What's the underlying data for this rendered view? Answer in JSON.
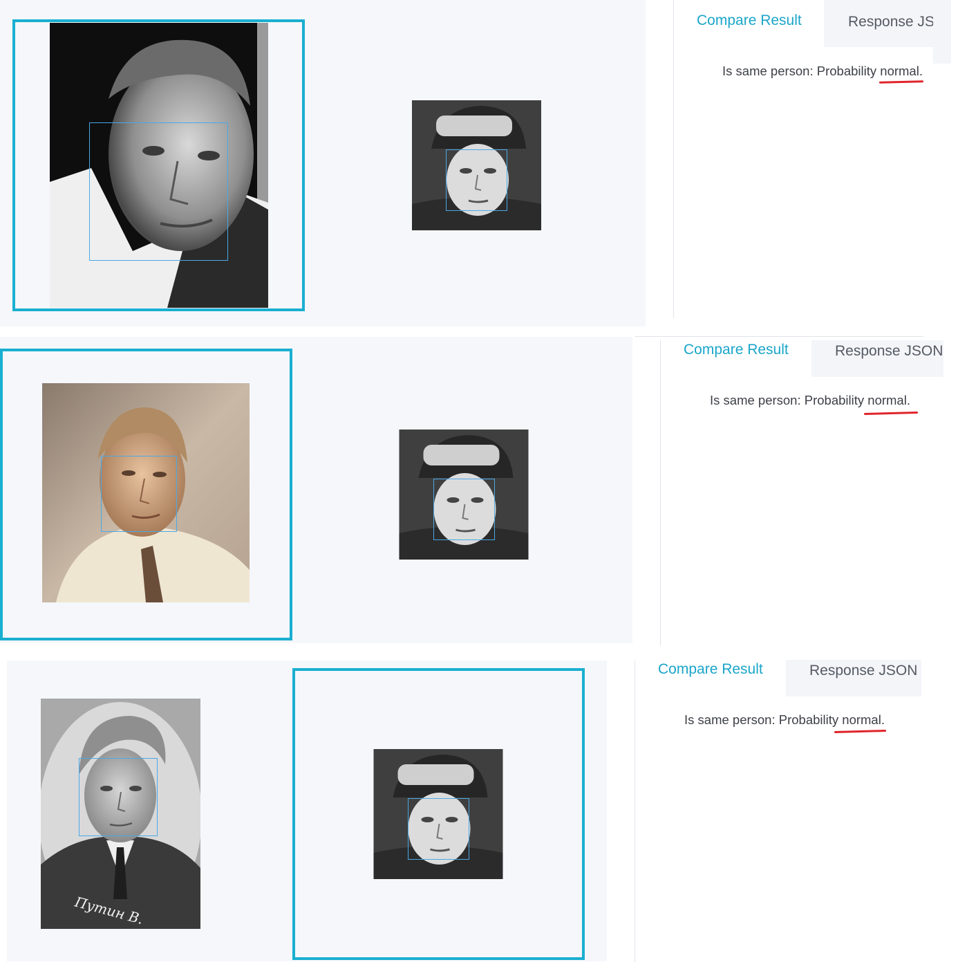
{
  "tabs": {
    "compare_result": "Compare Result",
    "response_json": "Response JSON",
    "response_json_cut": "Response JSC"
  },
  "result": {
    "prefix": "Is same person: Probability ",
    "value": "normal",
    "suffix": "."
  },
  "photo3_caption": "Путин   В.",
  "colors": {
    "accent": "#1aafd0",
    "face_box": "#4aa8e6",
    "underline": "#e0242b",
    "panel_bg": "#f5f7fb"
  }
}
